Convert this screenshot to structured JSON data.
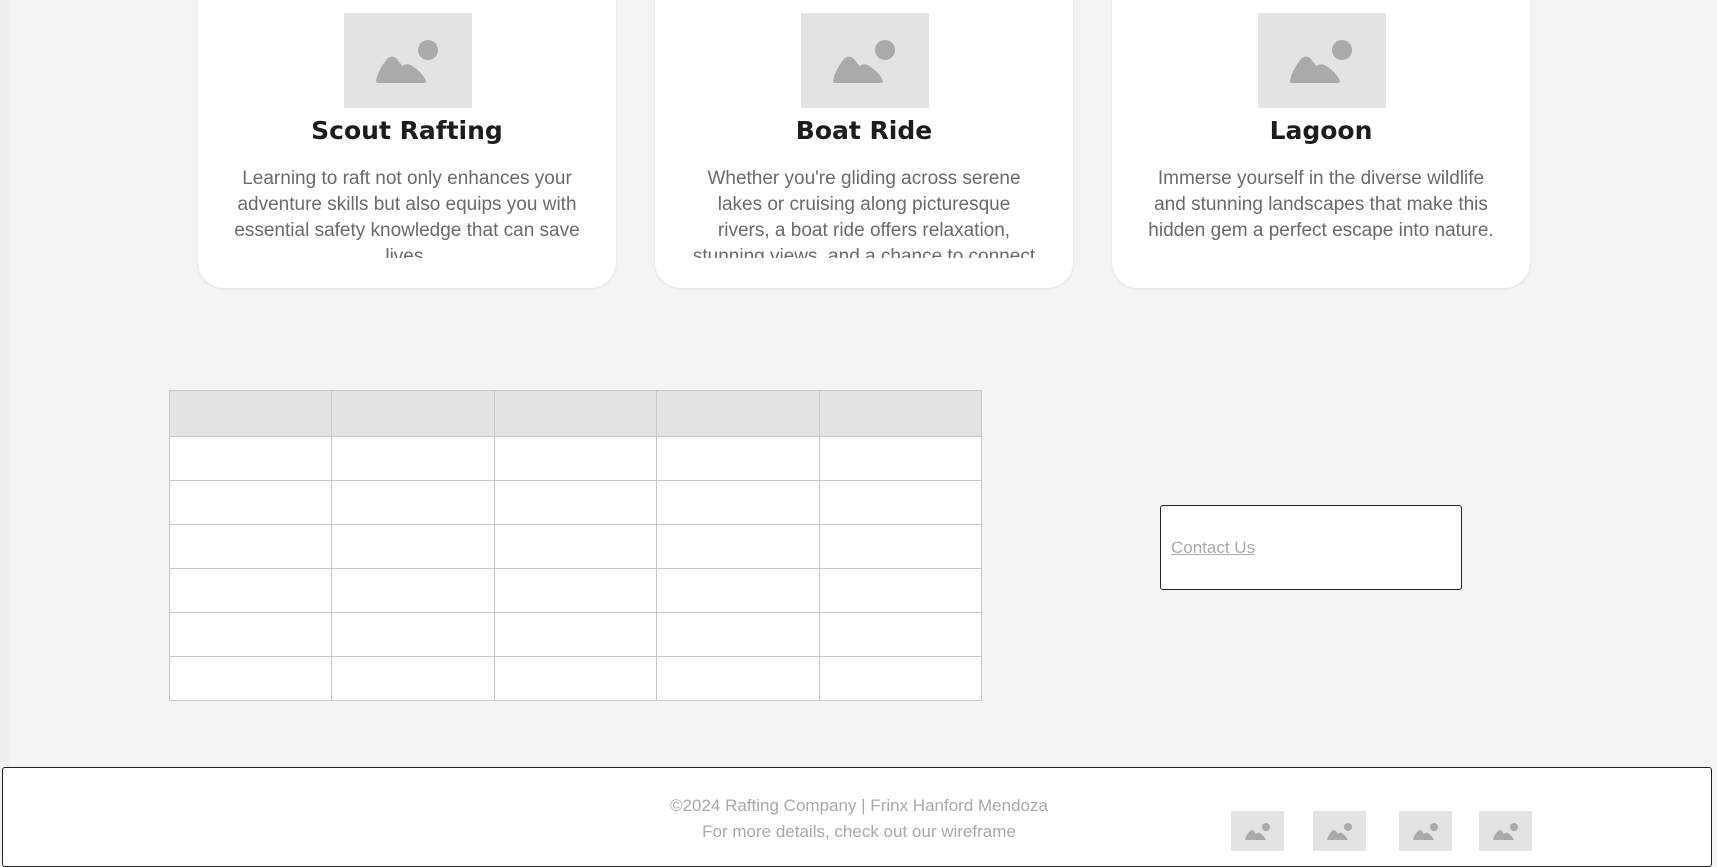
{
  "activities": [
    {
      "title": "Scout Rafting",
      "description": "Learning to raft not only enhances your adventure skills but also equips you with essential safety knowledge that can save lives."
    },
    {
      "title": "Boat Ride",
      "description": "Whether you're gliding across serene lakes or cruising along picturesque rivers, a boat ride offers relaxation, stunning views, and a chance to connect"
    },
    {
      "title": "Lagoon",
      "description": "Immerse yourself in the diverse wildlife and stunning landscapes that make this hidden gem a perfect escape into nature."
    }
  ],
  "contact": {
    "label": "Contact Us"
  },
  "footer": {
    "copyright": "©2024 Rafting Company | Frinx Hanford Mendoza",
    "details": "For more details, check out our wireframe",
    "social_icons": [
      "image-placeholder-icon",
      "image-placeholder-icon",
      "image-placeholder-icon",
      "image-placeholder-icon"
    ]
  },
  "colors": {
    "page_background": "#f4f4f4",
    "card_background": "#ffffff",
    "placeholder_fill": "#e3e3e3",
    "placeholder_glyph": "#aaaaaa",
    "title_text": "#1c1c1c",
    "body_text": "#6a6a6a",
    "muted_text": "#a9a9a9",
    "table_border": "#c9c9c9",
    "table_header": "#e3e3e3"
  }
}
